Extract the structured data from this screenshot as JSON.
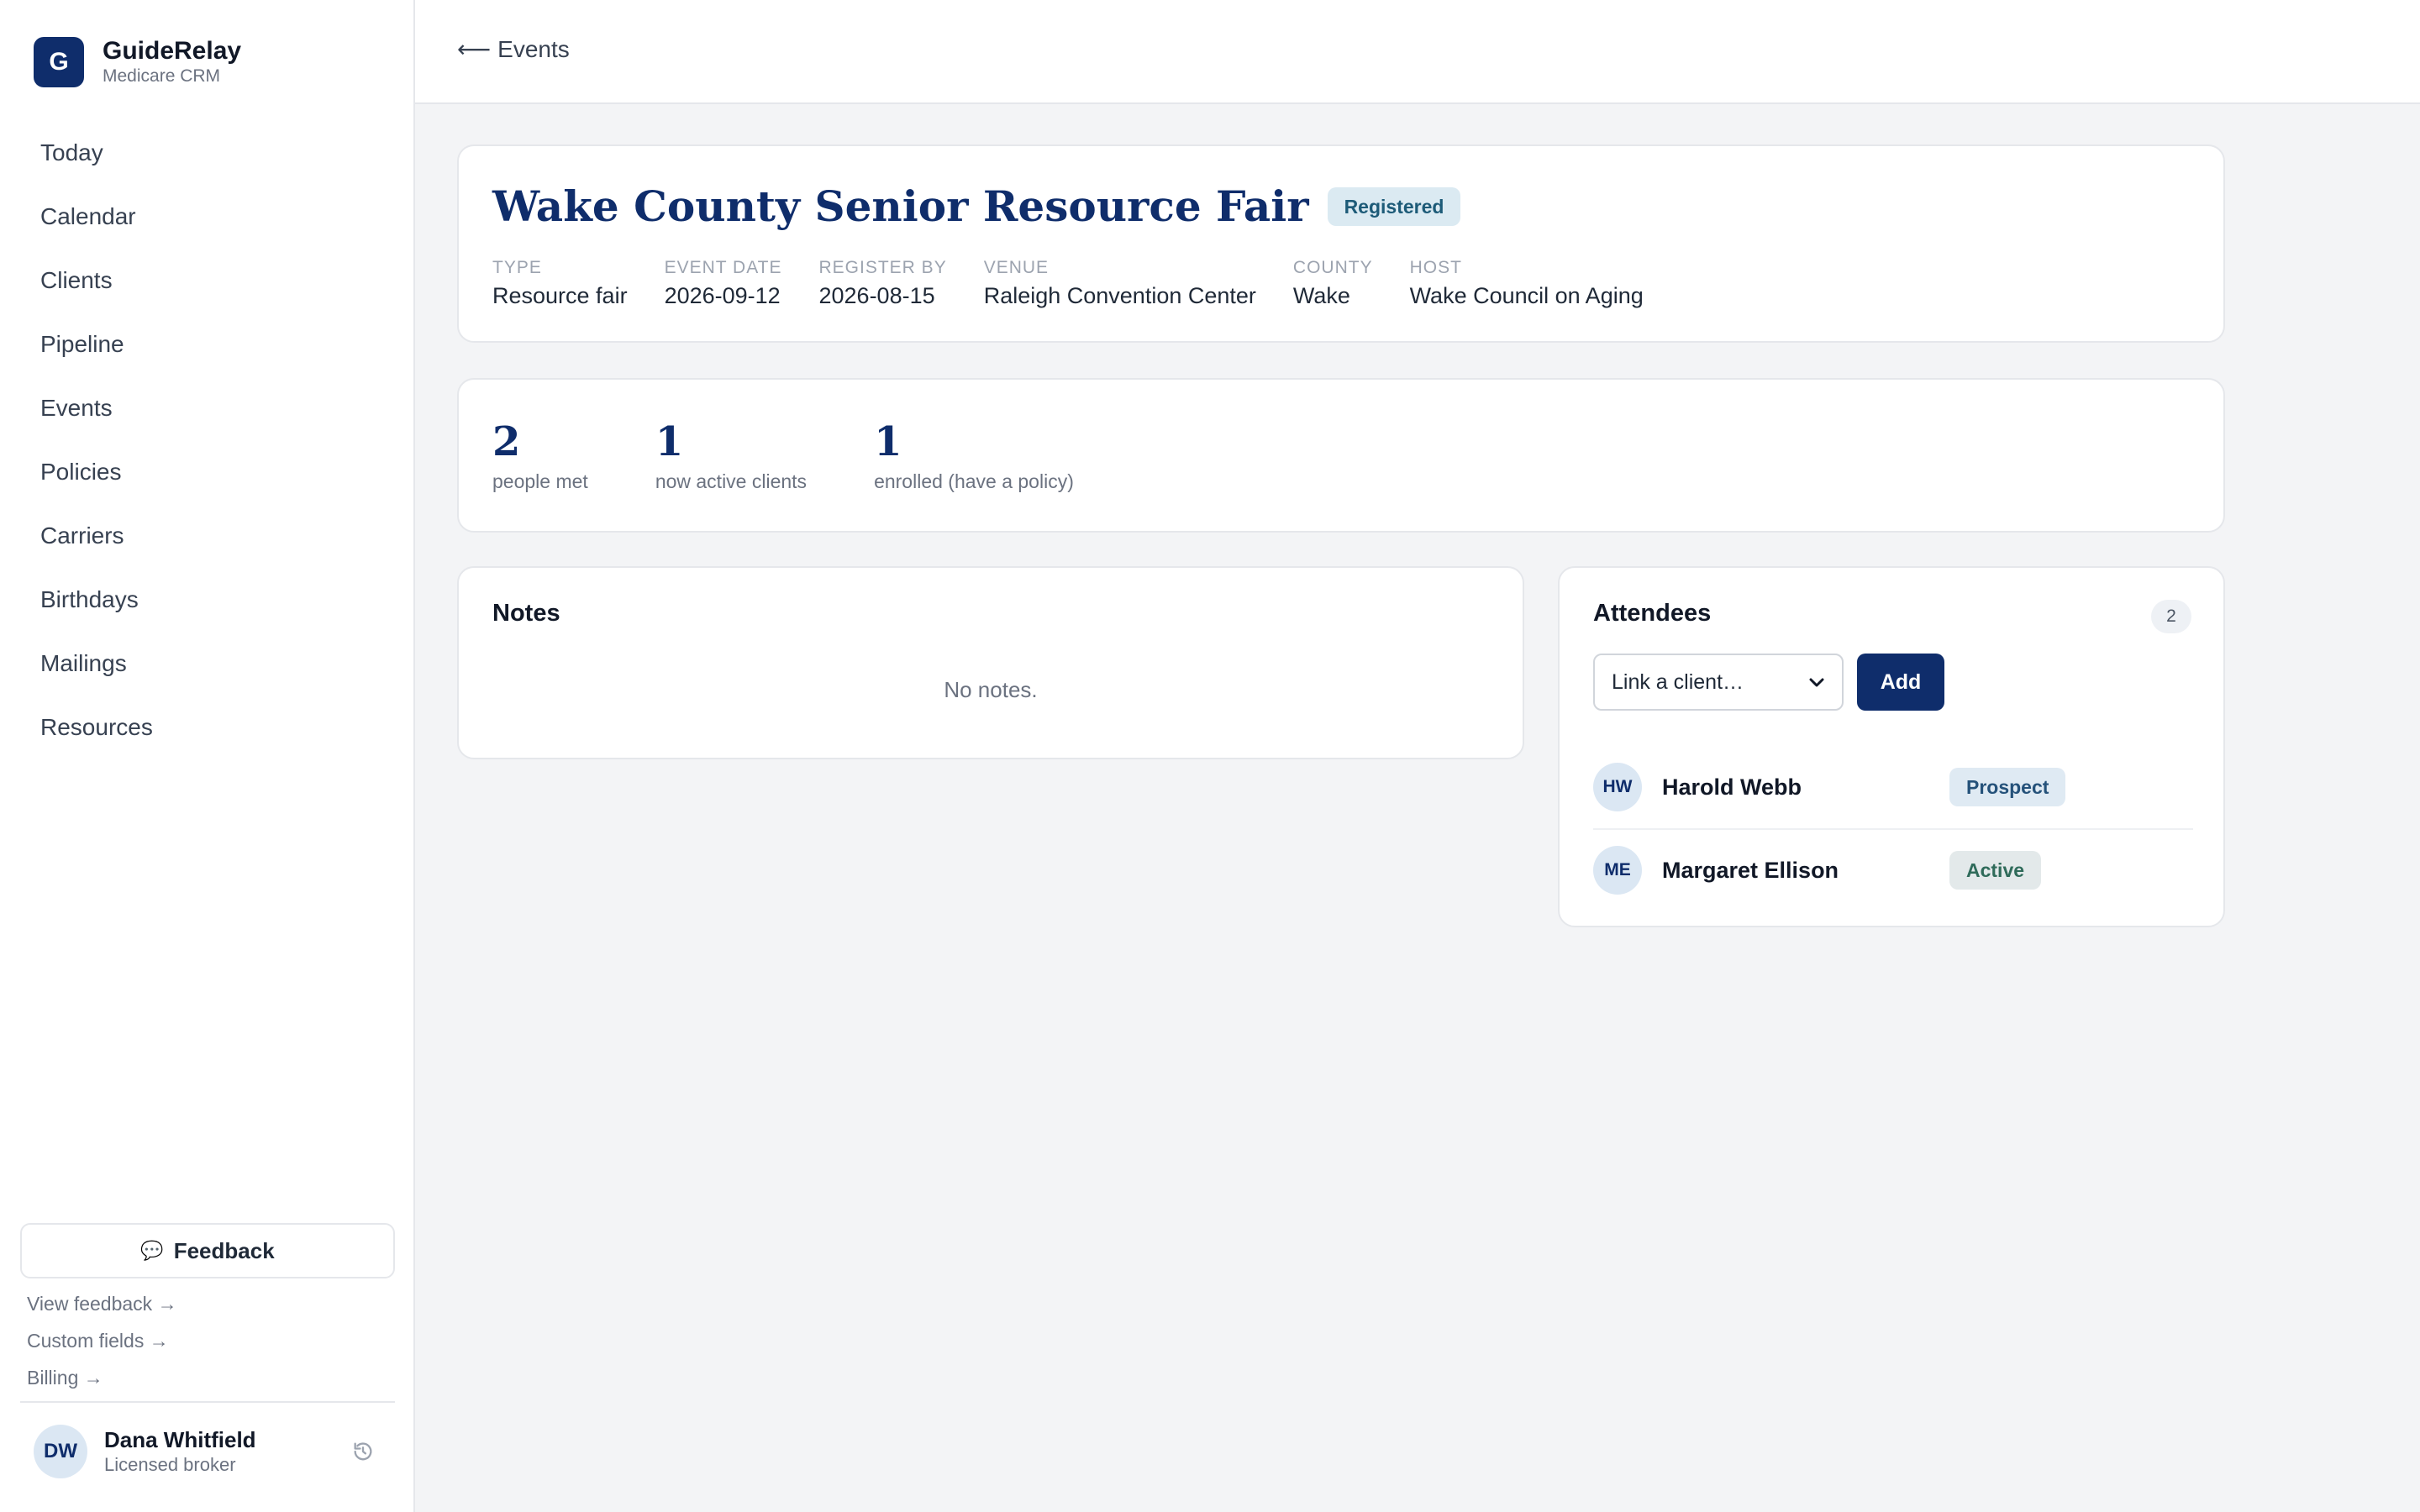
{
  "brand": {
    "logo_letter": "G",
    "name": "GuideRelay",
    "subtitle": "Medicare CRM"
  },
  "nav": {
    "items": [
      {
        "label": "Today",
        "icon": "today"
      },
      {
        "label": "Calendar",
        "icon": "calendar"
      },
      {
        "label": "Clients",
        "icon": "clients"
      },
      {
        "label": "Pipeline",
        "icon": "pipeline"
      },
      {
        "label": "Events",
        "icon": "events"
      },
      {
        "label": "Policies",
        "icon": "policies"
      },
      {
        "label": "Carriers",
        "icon": "carriers"
      },
      {
        "label": "Birthdays",
        "icon": "birthdays"
      },
      {
        "label": "Mailings",
        "icon": "mailings"
      },
      {
        "label": "Resources",
        "icon": "resources"
      }
    ]
  },
  "sidebar_footer": {
    "feedback_label": "Feedback",
    "feedback_icon": "speech-bubble-icon",
    "links": [
      "View feedback →",
      "Custom fields →",
      "Billing →"
    ]
  },
  "user": {
    "initials": "DW",
    "name": "Dana Whitfield",
    "role": "Licensed broker"
  },
  "topbar": {
    "back_label": "Events"
  },
  "event": {
    "title": "Wake County Senior Resource Fair",
    "status": "Registered",
    "meta": [
      {
        "label": "TYPE",
        "value": "Resource fair"
      },
      {
        "label": "EVENT DATE",
        "value": "2026-09-12"
      },
      {
        "label": "REGISTER BY",
        "value": "2026-08-15"
      },
      {
        "label": "VENUE",
        "value": "Raleigh Convention Center"
      },
      {
        "label": "COUNTY",
        "value": "Wake"
      },
      {
        "label": "HOST",
        "value": "Wake Council on Aging"
      }
    ]
  },
  "stats": [
    {
      "value": "2",
      "label": "people met"
    },
    {
      "value": "1",
      "label": "now active clients"
    },
    {
      "value": "1",
      "label": "enrolled (have a policy)"
    }
  ],
  "notes": {
    "title": "Notes",
    "empty_text": "No notes."
  },
  "attendees": {
    "title": "Attendees",
    "count": "2",
    "select_placeholder": "Link a client…",
    "add_label": "Add",
    "list": [
      {
        "initials": "HW",
        "name": "Harold Webb",
        "status": "Prospect"
      },
      {
        "initials": "ME",
        "name": "Margaret Ellison",
        "status": "Active"
      }
    ]
  },
  "colors": {
    "brand": "#0f2d6b",
    "background": "#f3f4f6"
  }
}
